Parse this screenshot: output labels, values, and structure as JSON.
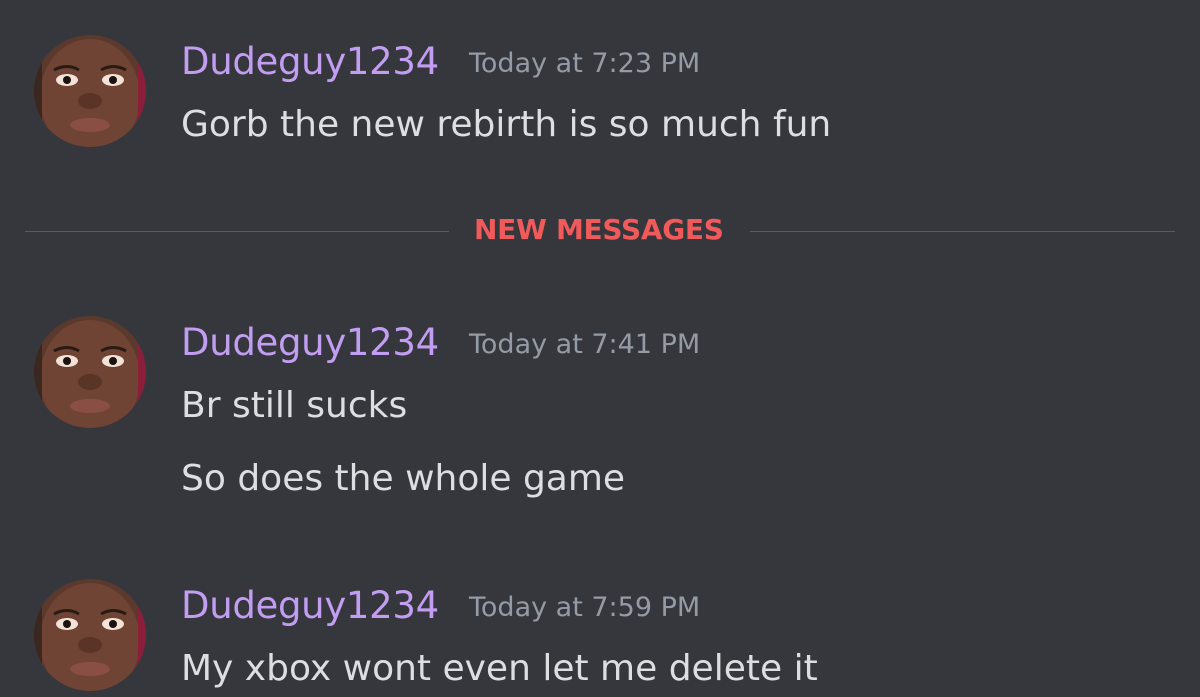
{
  "divider": {
    "label": "NEW MESSAGES",
    "line_color": "#a83a3d",
    "label_color": "#f05a5a"
  },
  "colors": {
    "background": "#36373d",
    "username": "#c29ef2",
    "timestamp": "#949ba4",
    "message": "#dcdee1"
  },
  "messages": [
    {
      "username": "Dudeguy1234",
      "timestamp": "Today at 7:23 PM",
      "lines": [
        "Gorb the new rebirth is so much fun"
      ]
    },
    {
      "username": "Dudeguy1234",
      "timestamp": "Today at 7:41 PM",
      "lines": [
        "Br still sucks",
        "So does the whole game"
      ]
    },
    {
      "username": "Dudeguy1234",
      "timestamp": "Today at 7:59 PM",
      "lines": [
        "My xbox wont even let me delete it"
      ]
    }
  ]
}
